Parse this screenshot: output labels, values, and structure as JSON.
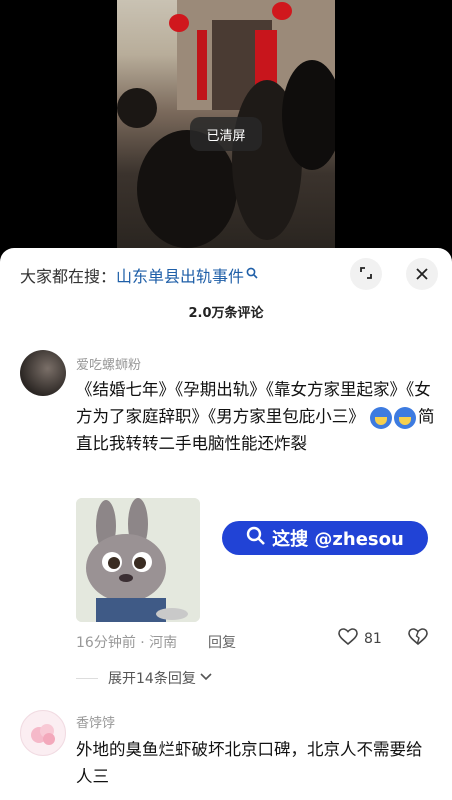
{
  "video": {
    "toast": "已清屏"
  },
  "comments_sheet": {
    "search_prefix": "大家都在搜：",
    "search_term": "山东单县出轨事件",
    "search_term_icon": "search-icon",
    "expand_icon": "expand-icon",
    "close_icon": "close-icon",
    "count": "2.0万条评论",
    "comments": [
      {
        "username": "爱吃螺蛳粉",
        "text": "《结婚七年》《孕期出轨》《靠女方家里起家》《女方为了家庭辞职》《男方家里包庇小三》",
        "text_after_emoji": "简直比我转转二手电脑性能还炸裂",
        "emoji_icons": [
          "crying-face-emoji",
          "crying-face-emoji"
        ],
        "time_location": "16分钟前 · 河南",
        "reply_label": "回复",
        "like_count": "81",
        "expand_label": "展开14条回复",
        "watermark_text": "这搜 @zhesou"
      },
      {
        "username": "香饽饽",
        "text": "外地的臭鱼烂虾破坏北京口碑，北京人不需要给人三"
      }
    ]
  }
}
